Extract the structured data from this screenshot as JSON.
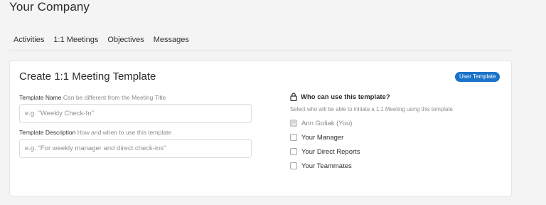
{
  "company": {
    "name": "Your Company"
  },
  "tabs": [
    {
      "label": "Activities"
    },
    {
      "label": "1:1 Meetings"
    },
    {
      "label": "Objectives"
    },
    {
      "label": "Messages"
    }
  ],
  "card": {
    "title": "Create 1:1 Meeting Template",
    "badge": "User Template",
    "template_name": {
      "label": "Template Name",
      "hint": "Can be different from the Meeting Title",
      "value": "",
      "placeholder": "e.g. \"Weekly Check-In\""
    },
    "template_description": {
      "label": "Template Description",
      "hint": "How and when to use this template",
      "value": "",
      "placeholder": "e.g. \"For weekly manager and direct check-ins\""
    },
    "who": {
      "title": "Who can use this template?",
      "subtitle": "Select who will be able to initiate a 1:1 Meeting using this template",
      "icon": "lock-icon",
      "options": [
        {
          "label": "Ann Goliak (You)",
          "checked": true,
          "disabled": true
        },
        {
          "label": "Your Manager",
          "checked": false,
          "disabled": false
        },
        {
          "label": "Your Direct Reports",
          "checked": false,
          "disabled": false
        },
        {
          "label": "Your Teammates",
          "checked": false,
          "disabled": false
        }
      ]
    }
  }
}
